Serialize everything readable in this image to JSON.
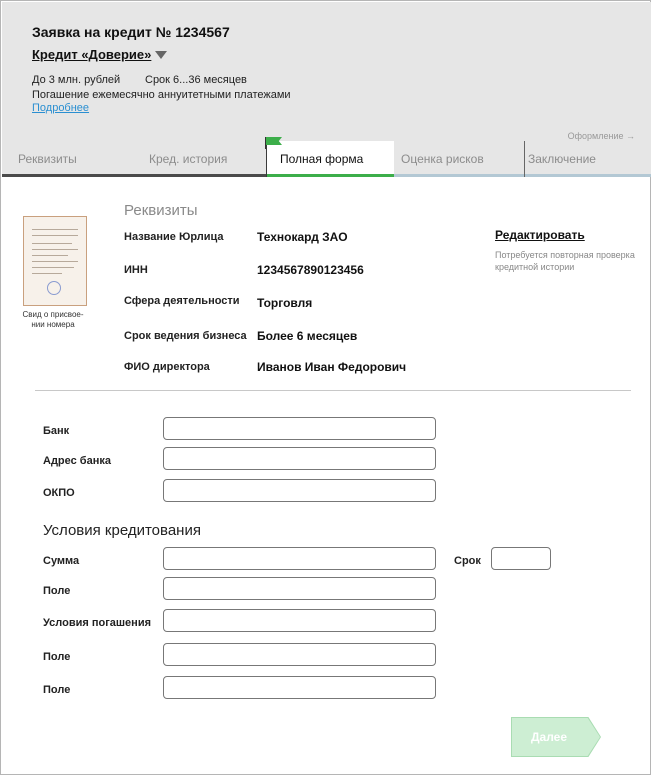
{
  "header": {
    "title": "Заявка на кредит № 1234567",
    "product": "Кредит «Доверие»",
    "limit": "До 3 млн. рублей",
    "term": "Срок 6...36 месяцев",
    "repayment": "Погашение ежемесячно аннуитетными платежами",
    "more_link": "Подробнее",
    "stage_hint": "Оформление →"
  },
  "tabs": [
    {
      "label": "Реквизиты",
      "bar_color": "#4a4a4a"
    },
    {
      "label": "Кред. история",
      "bar_color": "#4a4a4a"
    },
    {
      "label": "Полная форма",
      "bar_color": "#3cae4a",
      "active": true
    },
    {
      "label": "Оценка рисков",
      "bar_color": "#b3c8d4"
    },
    {
      "label": "Заключение",
      "bar_color": "#b3c8d4"
    }
  ],
  "document": {
    "caption": "Свид о присвое-\nнии номера"
  },
  "requisites": {
    "title": "Реквизиты",
    "rows": [
      {
        "label": "Название Юрлица",
        "value": "Технокард ЗАО"
      },
      {
        "label": "ИНН",
        "value": "1234567890123456"
      },
      {
        "label": "Сфера деятельности",
        "value": "Торговля"
      },
      {
        "label": "Срок ведения бизнеса",
        "value": "Более 6 месяцев"
      },
      {
        "label": "ФИО директора",
        "value": "Иванов Иван Федорович"
      }
    ],
    "edit_link": "Редактировать",
    "edit_note": "Потребуется повторная проверка кредитной истории"
  },
  "bank_fields": [
    {
      "label": "Банк",
      "value": ""
    },
    {
      "label": "Адрес банка",
      "value": ""
    },
    {
      "label": "ОКПО",
      "value": ""
    }
  ],
  "credit_terms": {
    "title": "Условия кредитования",
    "fields": [
      {
        "label": "Сумма",
        "value": ""
      },
      {
        "label": "Поле",
        "value": ""
      },
      {
        "label": "Условия погашения",
        "value": ""
      },
      {
        "label": "Поле",
        "value": ""
      },
      {
        "label": "Поле",
        "value": ""
      }
    ],
    "term_label": "Срок",
    "term_value": ""
  },
  "next_button": "Далее"
}
